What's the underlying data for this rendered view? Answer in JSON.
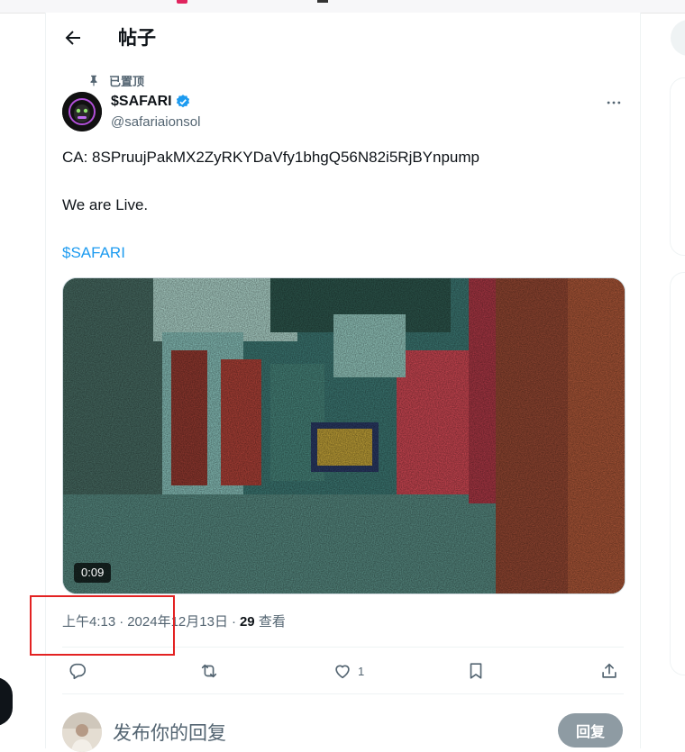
{
  "header": {
    "title": "帖子"
  },
  "post": {
    "pinned_label": "已置顶",
    "author_name": "$SAFARI",
    "author_handle": "@safariaionsol",
    "lines": [
      "CA: 8SPruujPakMX2ZyRKYDaVfy1bhgQ56N82i5RjBYnpump",
      "We are Live.",
      "$SAFARI"
    ],
    "video_duration": "0:09",
    "time": "上午4:13",
    "date": "2024年12月13日",
    "views_count": "29",
    "views_label": "查看",
    "likes": "1"
  },
  "reply": {
    "placeholder": "发布你的回复",
    "button_label": "回复"
  },
  "colors": {
    "accent": "#1d9bf0",
    "verified": "#1d9bf0",
    "highlight_box": "#e32222"
  }
}
